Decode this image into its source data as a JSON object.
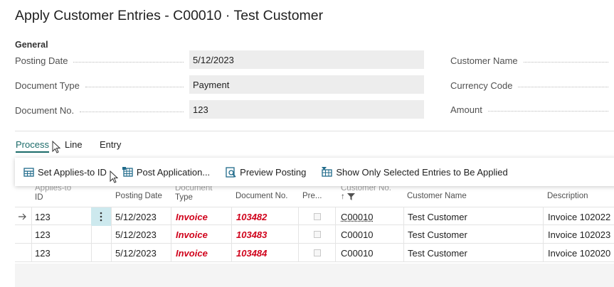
{
  "page": {
    "title": "Apply Customer Entries - C00010 · Test Customer"
  },
  "general": {
    "section_title": "General",
    "posting_date_label": "Posting Date",
    "posting_date_value": "5/12/2023",
    "document_type_label": "Document Type",
    "document_type_value": "Payment",
    "document_no_label": "Document No.",
    "document_no_value": "123",
    "customer_name_label": "Customer Name",
    "currency_code_label": "Currency Code",
    "amount_label": "Amount"
  },
  "tabs": [
    {
      "label": "Process",
      "active": true
    },
    {
      "label": "Line",
      "active": false
    },
    {
      "label": "Entry",
      "active": false
    }
  ],
  "toolbar": {
    "set_applies_to_id": "Set Applies-to ID",
    "post_application": "Post Application...",
    "preview_posting": "Preview Posting",
    "show_only_selected": "Show Only Selected Entries to Be Applied"
  },
  "columns": {
    "applies_to_id_line1": "Applies-to",
    "applies_to_id_line2": "ID",
    "posting_date": "Posting Date",
    "document_type_line1": "Document",
    "document_type_line2": "Type",
    "document_no": "Document No.",
    "pre": "Pre...",
    "customer_no_line1": "Customer No.",
    "customer_no_sort": "↑",
    "customer_name": "Customer Name",
    "description": "Description"
  },
  "rows": [
    {
      "applies_to_id": "123",
      "posting_date": "5/12/2023",
      "document_type": "Invoice",
      "document_no": "103482",
      "customer_no": "C00010",
      "customer_name": "Test Customer",
      "description": "Invoice 102022",
      "selected": true
    },
    {
      "applies_to_id": "123",
      "posting_date": "5/12/2023",
      "document_type": "Invoice",
      "document_no": "103483",
      "customer_no": "C00010",
      "customer_name": "Test Customer",
      "description": "Invoice 102023",
      "selected": false
    },
    {
      "applies_to_id": "123",
      "posting_date": "5/12/2023",
      "document_type": "Invoice",
      "document_no": "103484",
      "customer_no": "C00010",
      "customer_name": "Test Customer",
      "description": "Invoice 102020",
      "selected": false
    }
  ],
  "icons": {
    "row_selector": "arrow-right-icon",
    "row_menu": "vertical-ellipsis-icon",
    "filter": "filter-icon"
  },
  "colors": {
    "accent": "#1b6b69",
    "invoice_red": "#d0021b",
    "field_bg": "#ededed",
    "row_menu_bg": "#cde9ee",
    "toolbar_icon": "#1f6a8a"
  }
}
